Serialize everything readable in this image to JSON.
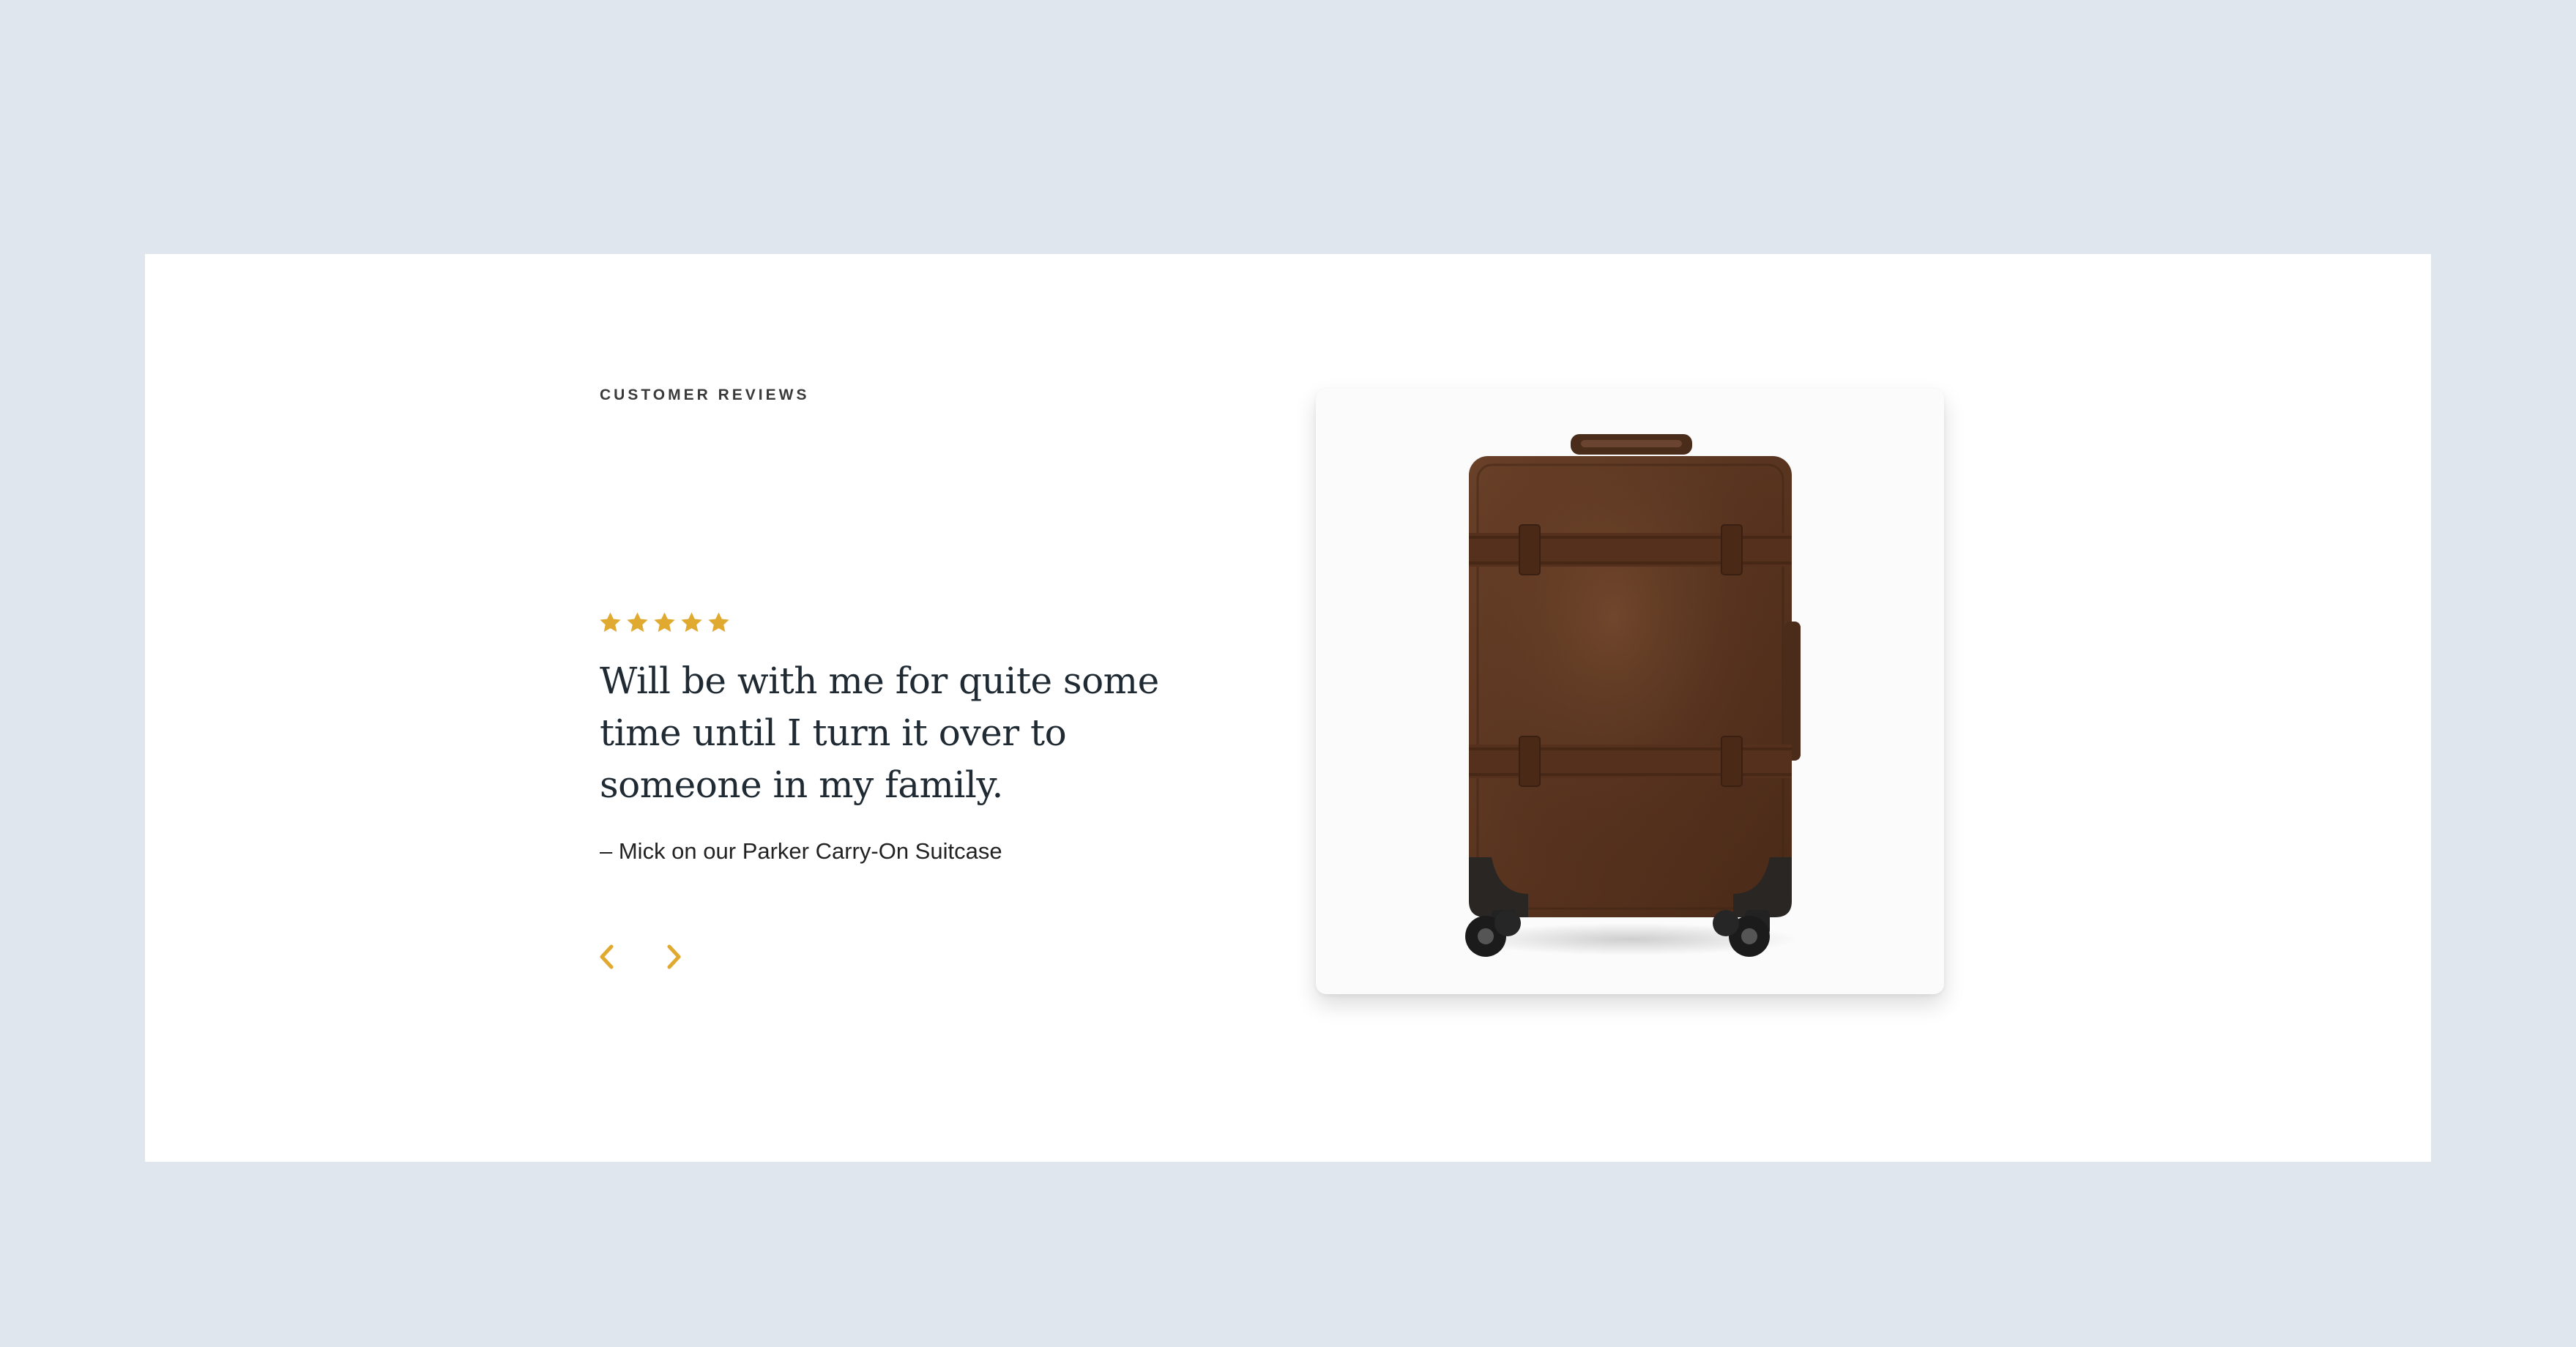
{
  "section": {
    "eyebrow": "CUSTOMER REVIEWS"
  },
  "review": {
    "rating": 5,
    "rating_max": 5,
    "quote": "Will be with me for quite some time until I turn it over to someone in my family.",
    "attribution": "– Mick on our Parker Carry-On Suitcase"
  },
  "colors": {
    "page_background": "#dfe6ee",
    "panel_background": "#ffffff",
    "accent_gold": "#e0a930",
    "text_dark": "#1f2a33",
    "leather_brown": "#5e3a24"
  },
  "icons": {
    "star": "star-icon",
    "prev": "chevron-left-icon",
    "next": "chevron-right-icon"
  }
}
